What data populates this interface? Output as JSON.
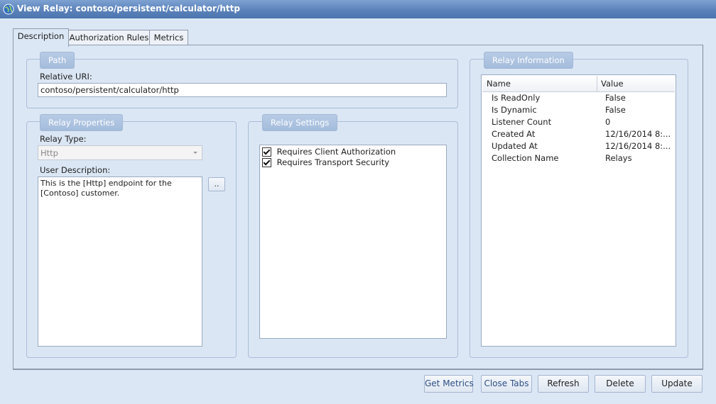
{
  "window": {
    "title": "View Relay: contoso/persistent/calculator/http"
  },
  "tabs": [
    {
      "label": "Description",
      "active": true
    },
    {
      "label": "Authorization Rules",
      "active": false
    },
    {
      "label": "Metrics",
      "active": false
    }
  ],
  "path": {
    "header": "Path",
    "relative_uri_label": "Relative URI:",
    "relative_uri_value": "contoso/persistent/calculator/http"
  },
  "relay_properties": {
    "header": "Relay Properties",
    "relay_type_label": "Relay Type:",
    "relay_type_value": "Http",
    "user_description_label": "User Description:",
    "user_description_value": "This is the [Http] endpoint for the [Contoso] customer.",
    "ellipsis_button": ".."
  },
  "relay_settings": {
    "header": "Relay Settings",
    "options": [
      {
        "label": "Requires Client Authorization",
        "checked": true
      },
      {
        "label": "Requires Transport Security",
        "checked": true
      }
    ]
  },
  "relay_information": {
    "header": "Relay Information",
    "columns": {
      "name": "Name",
      "value": "Value"
    },
    "rows": [
      {
        "name": "Is ReadOnly",
        "value": "False"
      },
      {
        "name": "Is Dynamic",
        "value": "False"
      },
      {
        "name": "Listener Count",
        "value": "0"
      },
      {
        "name": "Created At",
        "value": "12/16/2014 8:..."
      },
      {
        "name": "Updated At",
        "value": "12/16/2014 8:..."
      },
      {
        "name": "Collection Name",
        "value": "Relays"
      }
    ]
  },
  "buttons": {
    "get_metrics": "Get Metrics",
    "close_tabs": "Close Tabs",
    "refresh": "Refresh",
    "delete": "Delete",
    "update": "Update"
  },
  "icons": {
    "window": "globe-icon",
    "dropdown": "chevron-down-icon",
    "checkbox": "checkmark-icon"
  },
  "colors": {
    "titlebar": "#5b82ba",
    "background": "#dce7f5",
    "group_header": "#a4bcdc",
    "link_button_text": "#2c4f86"
  }
}
